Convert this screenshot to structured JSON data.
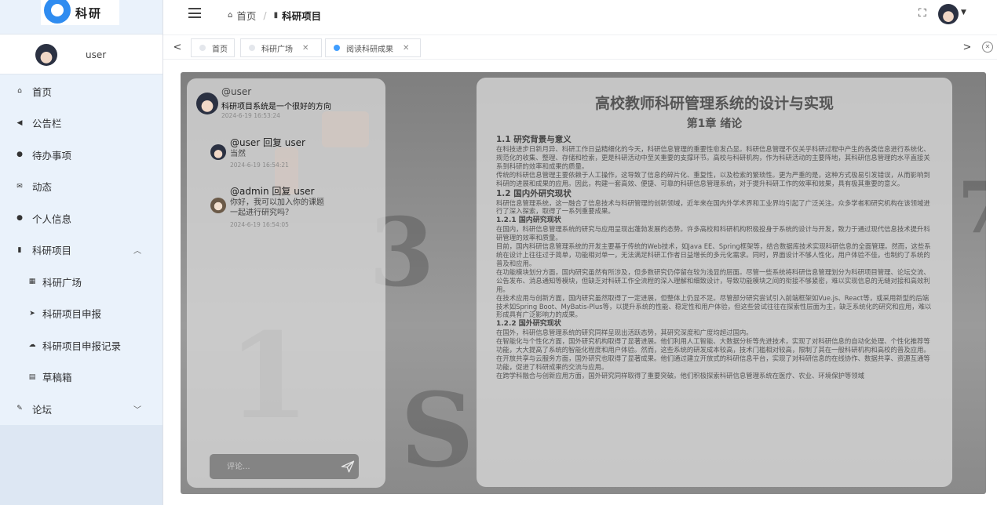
{
  "app": {
    "logo_text": "科研"
  },
  "sidebar": {
    "username": "user",
    "items": [
      {
        "label": "首页",
        "icon": "home-icon",
        "glyph": "⌂"
      },
      {
        "label": "公告栏",
        "icon": "megaphone-icon",
        "glyph": "◀"
      },
      {
        "label": "待办事项",
        "icon": "info-icon",
        "glyph": "●"
      },
      {
        "label": "动态",
        "icon": "mail-icon",
        "glyph": "✉"
      },
      {
        "label": "个人信息",
        "icon": "user-circle-icon",
        "glyph": "●"
      },
      {
        "label": "科研项目",
        "icon": "bookmark-icon",
        "glyph": "▮",
        "expanded": true
      },
      {
        "label": "科研广场",
        "icon": "grid-icon",
        "glyph": "▦"
      },
      {
        "label": "科研项目申报",
        "icon": "send-icon",
        "glyph": "➤"
      },
      {
        "label": "科研项目申报记录",
        "icon": "cloud-icon",
        "glyph": "☁"
      },
      {
        "label": "草稿箱",
        "icon": "document-icon",
        "glyph": "▤"
      },
      {
        "label": "论坛",
        "icon": "edit-icon",
        "glyph": "✎",
        "expanded": false
      }
    ]
  },
  "header": {
    "breadcrumb": [
      {
        "label": "首页"
      },
      {
        "label": "科研项目"
      }
    ]
  },
  "tabs": [
    {
      "label": "首页",
      "closable": false,
      "active": false
    },
    {
      "label": "科研广场",
      "closable": true,
      "active": false
    },
    {
      "label": "阅读科研成果",
      "closable": true,
      "active": true
    }
  ],
  "comments": {
    "main": {
      "user": "@user",
      "text": "科研项目系统是一个很好的方向",
      "time": "2024-6-19 16:53:24"
    },
    "replies": [
      {
        "head": "@user 回复 user",
        "text": "当然",
        "time": "2024-6-19 16:54:21"
      },
      {
        "head": "@admin 回复 user",
        "text": "你好，我可以加入你的课题一起进行研究吗？",
        "time": "2024-6-19 16:54:05"
      }
    ],
    "input_placeholder": "评论..."
  },
  "paper": {
    "title": "高校教师科研管理系统的设计与实现",
    "chapter": "第1章 绪论",
    "s1_heading": "1.1 研究背景与意义",
    "s1_p1": "在科技进步日新月异、科研工作日益精细化的今天，科研信息管理的重要性愈发凸显。科研信息管理不仅关乎科研过程中产生的各类信息进行系统化、规范化的收集、整理、存储和检索，更是科研活动中至关重要的支撑环节。高校与科研机构，作为科研活动的主要阵地，其科研信息管理的水平直接关系到科研的效率和成果的质量。",
    "s1_p2": "传统的科研信息管理主要依赖于人工操作，这导致了信息的碎片化、重复性，以及检索的繁琐性。更为严重的是，这种方式极易引发错误，从而影响到科研的进展和成果的应用。因此，构建一套高效、便捷、可靠的科研信息管理系统，对于提升科研工作的效率和效果，具有极其重要的意义。",
    "s2_heading": "1.2 国内外研究现状",
    "s2_p1": "科研信息管理系统，这一融合了信息技术与科研管理的创新领域，近年来在国内外学术界和工业界均引起了广泛关注。众多学者和研究机构在该领域进行了深入探索，取得了一系列重要成果。",
    "s21_heading": "1.2.1 国内研究现状",
    "s21_p1": "在国内，科研信息管理系统的研究与应用呈现出蓬勃发展的态势。许多高校和科研机构积极投身于系统的设计与开发，致力于通过现代信息技术提升科研管理的效率和质量。",
    "s21_p2": "目前，国内科研信息管理系统的开发主要基于传统的Web技术，如Java EE、Spring框架等，结合数据库技术实现科研信息的全面管理。然而，这些系统在设计上往往过于简单，功能相对单一，无法满足科研工作者日益增长的多元化需求。同时，界面设计不够人性化，用户体验不佳，也制约了系统的普及和应用。",
    "s21_p3": "在功能模块划分方面，国内研究虽然有所涉及，但多数研究仍停留在较为浅显的层面。尽管一些系统将科研信息管理划分为科研项目管理、论坛交流、公告发布、消息通知等模块，但缺乏对科研工作全流程的深入理解和细致设计，导致功能模块之间的衔接不够紧密，难以实现信息的无缝对接和高效利用。",
    "s21_p4": "在技术应用与创新方面，国内研究虽然取得了一定进展，但整体上仍显不足。尽管部分研究尝试引入前端框架如Vue.js、React等，或采用新型的后端技术如Spring Boot、MyBatis-Plus等，以提升系统的性能、稳定性和用户体验，但这些尝试往往在探索性层面为主，缺乏系统化的研究和应用，难以形成具有广泛影响力的成果。",
    "s22_heading": "1.2.2 国外研究现状",
    "s22_p1": "在国外，科研信息管理系统的研究同样呈现出活跃态势，其研究深度和广度均超过国内。",
    "s22_p2": "在智能化与个性化方面，国外研究机构取得了显著进展。他们利用人工智能、大数据分析等先进技术，实现了对科研信息的自动化处理、个性化推荐等功能，大大提高了系统的智能化程度和用户体验。然而，这些系统的研发成本较高，技术门槛相对较高，限制了其在一般科研机构和高校的普及应用。",
    "s22_p3": "在开放共享与云服务方面，国外研究也取得了显著成果。他们通过建立开放式的科研信息平台，实现了对科研信息的在线协作、数据共享、资源互通等功能，促进了科研成果的交流与应用。",
    "s22_p4": "在跨学科融合与创新应用方面，国外研究同样取得了重要突破。他们积极探索科研信息管理系统在医疗、农业、环境保护等领域"
  }
}
